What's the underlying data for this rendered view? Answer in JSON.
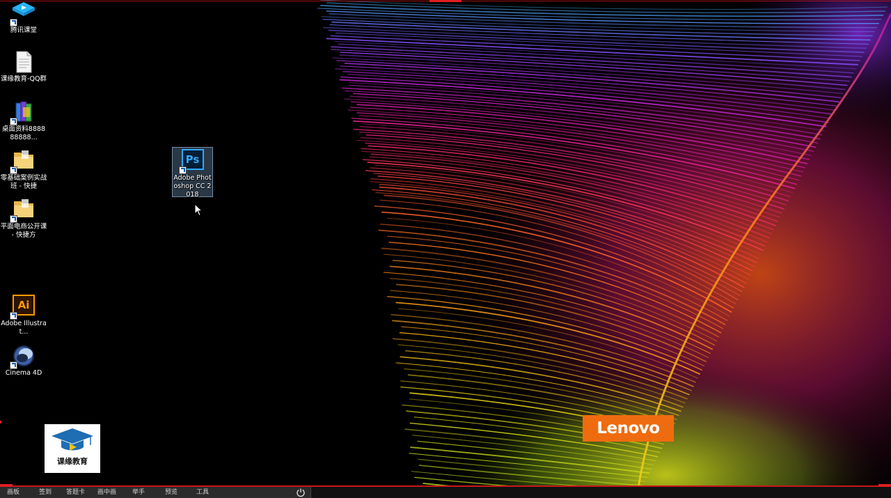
{
  "desktop": {
    "icons": [
      {
        "label": "腾讯课堂",
        "icon": "tencent-classroom-icon"
      },
      {
        "label": "课缘教育-QQ群",
        "icon": "text-document-icon"
      },
      {
        "label": "桌面资料888888888...",
        "icon": "books-icon"
      },
      {
        "label": "零基础案例实战班 - 快捷",
        "icon": "folder-icon"
      },
      {
        "label": "平面电商公开课 - 快捷方",
        "icon": "folder-icon"
      },
      {
        "label": "Adobe Illustrat...",
        "icon": "illustrator-icon",
        "glyph": "Ai"
      },
      {
        "label": "Cinema 4D",
        "icon": "cinema4d-icon"
      }
    ],
    "selected_icon": {
      "label": "Adobe Photoshop CC 2018",
      "icon": "photoshop-icon",
      "glyph": "Ps"
    }
  },
  "wallpaper": {
    "brand": "Lenovo"
  },
  "watermark": {
    "title": "课缘教育"
  },
  "toolbar": {
    "items": [
      "画板",
      "签到",
      "答题卡",
      "画中画",
      "举手",
      "预览",
      "工具"
    ],
    "power": "power-icon"
  },
  "colors": {
    "photoshop": "#31a8ff",
    "illustrator": "#ff9a00",
    "lenovo": "#ef6b0f",
    "frame": "#c8171b"
  }
}
